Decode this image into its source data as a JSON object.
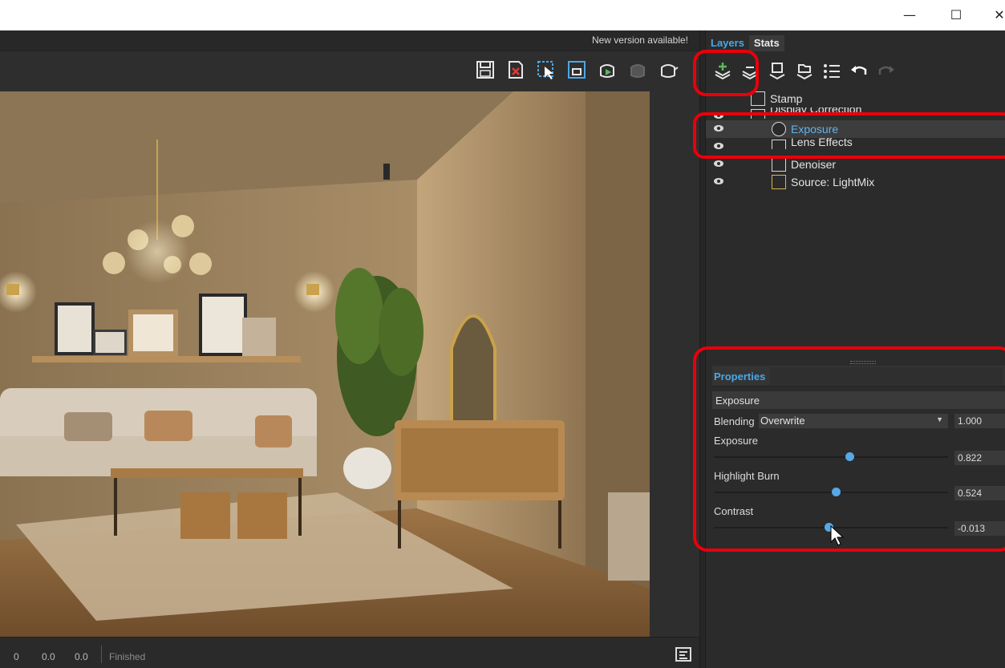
{
  "window": {
    "minimize_icon": "minimize-icon",
    "maximize_icon": "maximize-icon",
    "close_icon": "close-icon"
  },
  "viewer": {
    "notice": "New version available!",
    "toolbar_icons": [
      "save-icon",
      "clear-image-icon",
      "region-render-icon",
      "frame-icon",
      "render-teapot-icon",
      "render-teapot-disabled-icon",
      "teapot-icon"
    ],
    "status": {
      "v1": "0",
      "v2": "0.0",
      "v3": "0.0",
      "state": "Finished"
    }
  },
  "panel": {
    "tabs": [
      {
        "label": "Layers",
        "active": true
      },
      {
        "label": "Stats",
        "active": false
      }
    ],
    "layer_toolbar_icons": [
      "add-layer-icon",
      "remove-layer-icon",
      "save-layer-icon",
      "load-layer-icon",
      "list-icon",
      "undo-icon",
      "redo-icon"
    ],
    "layers": [
      {
        "name": "Stamp",
        "visible_eye": false,
        "selected": false
      },
      {
        "name": "Display Correction",
        "visible_eye": true,
        "selected": false
      },
      {
        "name": "Exposure",
        "visible_eye": true,
        "selected": true
      },
      {
        "name": "Lens Effects",
        "visible_eye": true,
        "selected": false
      },
      {
        "name": "Denoiser",
        "visible_eye": true,
        "selected": false
      },
      {
        "name": "Source: LightMix",
        "visible_eye": true,
        "selected": false
      }
    ]
  },
  "properties": {
    "title": "Properties",
    "layer_name": "Exposure",
    "blending_label": "Blending",
    "blending_value": "Overwrite",
    "blending_amount": "1.000",
    "params": [
      {
        "label": "Exposure",
        "value": "0.822",
        "fraction": 0.58
      },
      {
        "label": "Highlight Burn",
        "value": "0.524",
        "fraction": 0.52
      },
      {
        "label": "Contrast",
        "value": "-0.013",
        "fraction": 0.49
      }
    ]
  },
  "colors": {
    "accent": "#4aa8e8",
    "annotation": "#e8000b",
    "panel_bg": "#2b2b2b"
  }
}
